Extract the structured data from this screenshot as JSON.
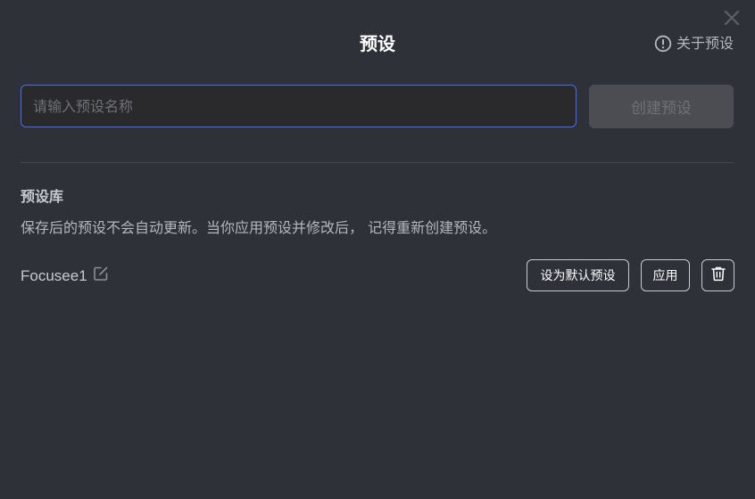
{
  "dialog": {
    "title": "预设",
    "about_label": "关于预设",
    "close_icon": "close-icon",
    "about_icon": "info-circle-icon"
  },
  "create": {
    "placeholder": "请输入预设名称",
    "value": "",
    "button_label": "创建预设"
  },
  "library": {
    "title": "预设库",
    "description": "保存后的预设不会自动更新。当你应用预设并修改后， 记得重新创建预设。",
    "presets": [
      {
        "name": "Focusee1",
        "edit_icon": "edit-icon",
        "set_default_label": "设为默认预设",
        "apply_label": "应用",
        "delete_icon": "trash-icon"
      }
    ]
  },
  "colors": {
    "background": "#2f3139",
    "accent_border": "#4a6cf0",
    "disabled_button": "#4b4d52"
  }
}
